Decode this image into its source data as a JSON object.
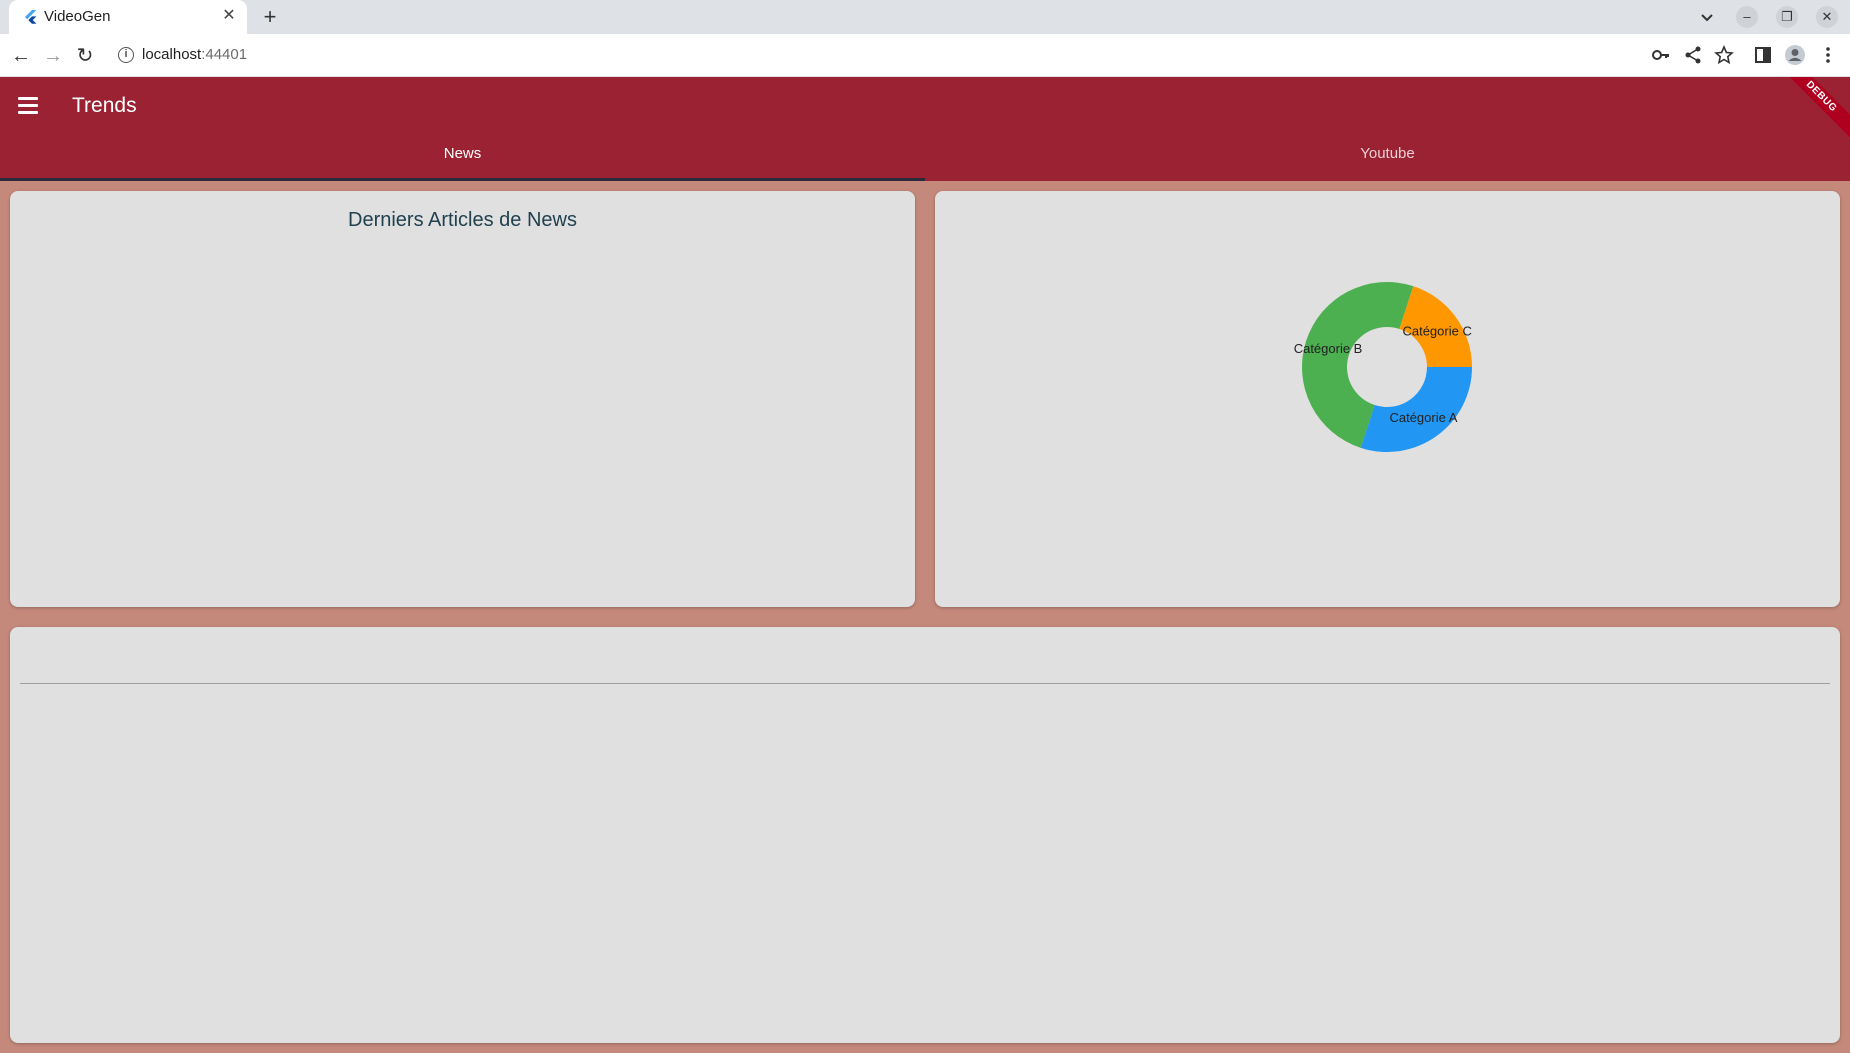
{
  "browser": {
    "tab_title": "VideoGen",
    "url_host": "localhost",
    "url_port": ":44401",
    "icons": [
      "flutter-favicon",
      "back-icon",
      "forward-icon",
      "reload-icon",
      "info-icon",
      "key-icon",
      "share-icon",
      "star-icon",
      "sidepanel-icon",
      "profile-icon",
      "more-icon"
    ]
  },
  "app": {
    "title": "Trends",
    "debug_label": "DEBUG",
    "tabs": [
      {
        "label": "News",
        "active": true
      },
      {
        "label": "Youtube",
        "active": false
      }
    ],
    "news_card_title": "Derniers Articles de News",
    "colors": {
      "appbar": "#9a2233",
      "background": "#c4897b",
      "card": "#e0e0e0"
    }
  },
  "chart_data": {
    "type": "pie",
    "donut": true,
    "title": "",
    "categories": [
      "Catégorie A",
      "Catégorie B",
      "Catégorie C"
    ],
    "values": [
      30,
      50,
      20
    ],
    "colors": [
      "#2196f3",
      "#4caf50",
      "#ff9800"
    ]
  }
}
